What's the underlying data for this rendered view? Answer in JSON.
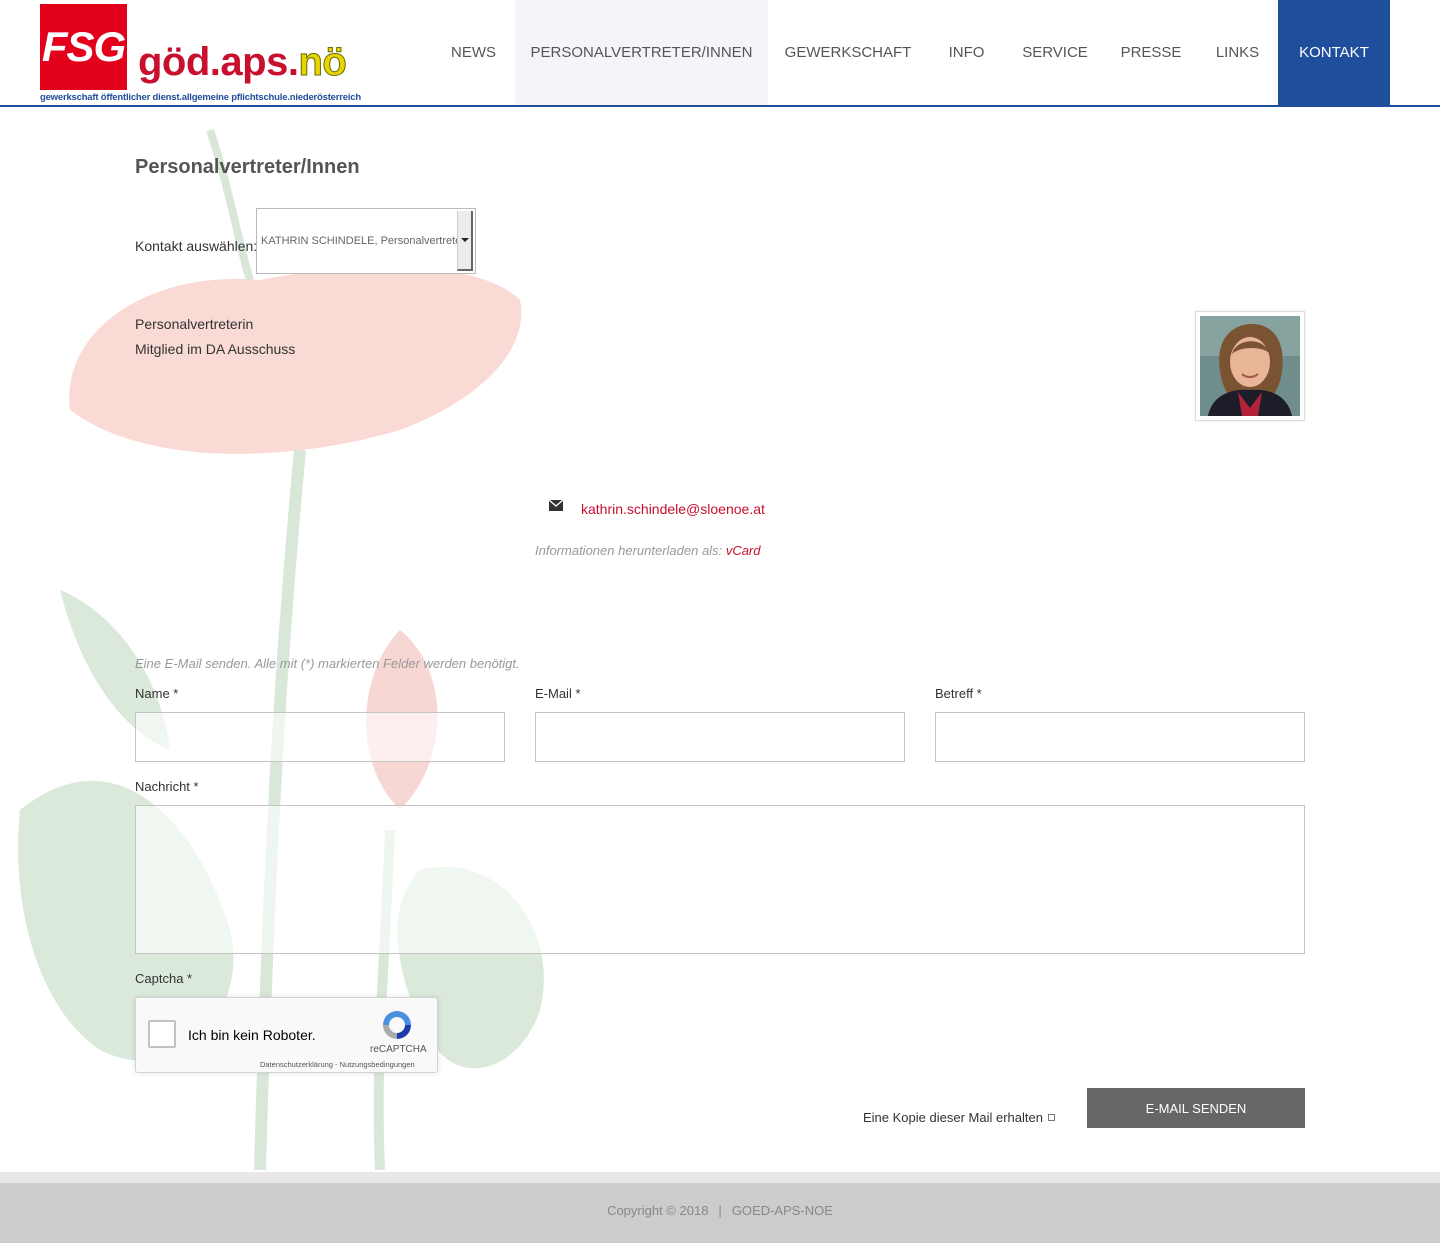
{
  "header": {
    "logo": {
      "fsg": "FSG",
      "brand_main": "göd.aps.",
      "brand_accent": "nö",
      "tagline": "gewerkschaft öffentlicher dienst.allgemeine pflichtschule.niederösterreich"
    },
    "nav": [
      {
        "label": "NEWS",
        "state": "normal"
      },
      {
        "label": "PERSONALVERTRETER/INNEN",
        "state": "hover"
      },
      {
        "label": "GEWERKSCHAFT",
        "state": "normal"
      },
      {
        "label": "INFO",
        "state": "normal"
      },
      {
        "label": "SERVICE",
        "state": "normal"
      },
      {
        "label": "PRESSE",
        "state": "normal"
      },
      {
        "label": "LINKS",
        "state": "normal"
      },
      {
        "label": "KONTAKT",
        "state": "active"
      }
    ]
  },
  "contact": {
    "page_title": "Personalvertreter/Innen",
    "select_label": "Kontakt auswählen:",
    "selected_contact": "KATHRIN SCHINDELE, Personalvertreterin",
    "role_line_1": "Personalvertreterin",
    "role_line_2": "Mitglied im DA Ausschuss",
    "email_icon": "envelope-icon",
    "email": "kathrin.schindele@sloenoe.at",
    "vcard_prefix": "Informationen herunterladen als:",
    "vcard_link": "vCard"
  },
  "form": {
    "intro": "Eine E-Mail senden. Alle mit (*) markierten Felder werden benötigt.",
    "name_label": "Name *",
    "email_label": "E-Mail *",
    "subject_label": "Betreff *",
    "message_label": "Nachricht *",
    "captcha_label": "Captcha *",
    "recaptcha_text": "Ich bin kein Roboter.",
    "recaptcha_brand": "reCAPTCHA",
    "recaptcha_links": "Datenschutzerklärung - Nutzungsbedingungen",
    "copy_label": "Eine Kopie dieser Mail erhalten",
    "submit_label": "E-MAIL SENDEN"
  },
  "footer": {
    "copyright": "Copyright © 2018",
    "separator": "|",
    "site": "GOED-APS-NOE"
  },
  "colors": {
    "brand_blue": "#1f4e9c",
    "brand_red": "#c8102e",
    "button_gray": "#666666",
    "footer_gray": "#cccccc"
  }
}
